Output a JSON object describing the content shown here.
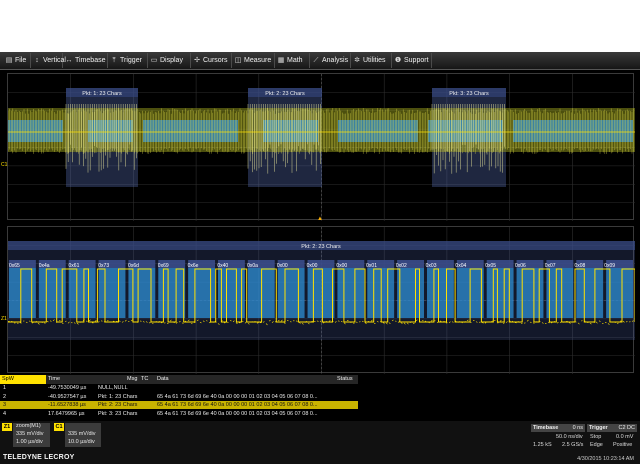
{
  "menu": [
    {
      "label": "File",
      "icon": "file-icon",
      "glyph": "▤"
    },
    {
      "label": "Vertical",
      "icon": "vertical-icon",
      "glyph": "↕"
    },
    {
      "label": "Timebase",
      "icon": "timebase-icon",
      "glyph": "↔"
    },
    {
      "label": "Trigger",
      "icon": "trigger-icon",
      "glyph": "⤒"
    },
    {
      "label": "Display",
      "icon": "display-icon",
      "glyph": "▭"
    },
    {
      "label": "Cursors",
      "icon": "cursors-icon",
      "glyph": "✢"
    },
    {
      "label": "Measure",
      "icon": "measure-icon",
      "glyph": "◫"
    },
    {
      "label": "Math",
      "icon": "math-icon",
      "glyph": "▦"
    },
    {
      "label": "Analysis",
      "icon": "analysis-icon",
      "glyph": "⟋"
    },
    {
      "label": "Utilities",
      "icon": "utilities-icon",
      "glyph": "✲"
    },
    {
      "label": "Support",
      "icon": "support-icon",
      "glyph": "❶"
    }
  ],
  "top_trace": {
    "packets": [
      "Pkt: 1: 23 Chars",
      "Pkt: 2: 23 Chars",
      "Pkt: 3: 23 Chars"
    ],
    "channel_marker": "C1"
  },
  "zoom_trace": {
    "packet": "Pkt: 2: 23 Chars",
    "channel_marker": "Z1",
    "bytes": [
      "0x65",
      "0x4a",
      "0x61",
      "0x73",
      "0x6d",
      "0x69",
      "0x6e",
      "0x40",
      "0x0a",
      "0x00",
      "0x00",
      "0x00",
      "0x01",
      "0x02",
      "0x03",
      "0x04",
      "0x05",
      "0x06",
      "0x07",
      "0x08",
      "0x09"
    ]
  },
  "table": {
    "headers": {
      "spw": "SpW",
      "time": "Time",
      "msg": "Msg",
      "tc": "TC",
      "data": "Data",
      "status": "Status"
    },
    "rows": [
      {
        "index": "1",
        "time": "-49.7530049 µs",
        "msg": "NULL,NULL",
        "tc": "",
        "data": "",
        "status": ""
      },
      {
        "index": "2",
        "time": "-40.9527547 µs",
        "msg": "Pkt: 1: 23 Chars",
        "tc": "",
        "data": "65 4a 61 73 6d 69 6e 40 0a 00 00 00 01 02 03 04 05 06 07 08 0...",
        "status": ""
      },
      {
        "index": "3",
        "time": "-11.6527838 µs",
        "msg": "Pkt: 2: 23 Chars",
        "tc": "",
        "data": "65 4a 61 73 6d 69 6e 40 0a 00 00 00 01 02 03 04 05 06 07 08 0...",
        "status": "",
        "selected": true
      },
      {
        "index": "4",
        "time": "17.6479965 µs",
        "msg": "Pkt: 3: 23 Chars",
        "tc": "",
        "data": "65 4a 61 73 6d 69 6e 40 0a 00 00 00 01 02 03 04 05 06 07 08 0...",
        "status": ""
      }
    ]
  },
  "descriptors": {
    "z1": {
      "badge": "Z1",
      "title": "zoom(M1)",
      "line1": "335 mV/div",
      "line2": "1.00 µs/div"
    },
    "c1": {
      "badge": "C1",
      "line1": "335 mV/div",
      "line2": "10.0 µs/div"
    }
  },
  "timebase": {
    "label": "Timebase",
    "offset": "0 ns",
    "per_div": "50.0 ns/div",
    "samples": "1.25 kS",
    "rate": "2.5 GS/s"
  },
  "trigger": {
    "label": "Trigger",
    "source": "C2 DC",
    "mode": "Stop",
    "level": "0.0 mV",
    "type": "Edge",
    "slope": "Positive"
  },
  "logo": "TELEDYNE LECROY",
  "datetime": "4/30/2015 10:23:14 AM",
  "colors": {
    "trace": "#ffe100",
    "packet_fill": "#2f8fd6",
    "selected_row": "#c9b400",
    "grid": "#3a3a3a"
  }
}
